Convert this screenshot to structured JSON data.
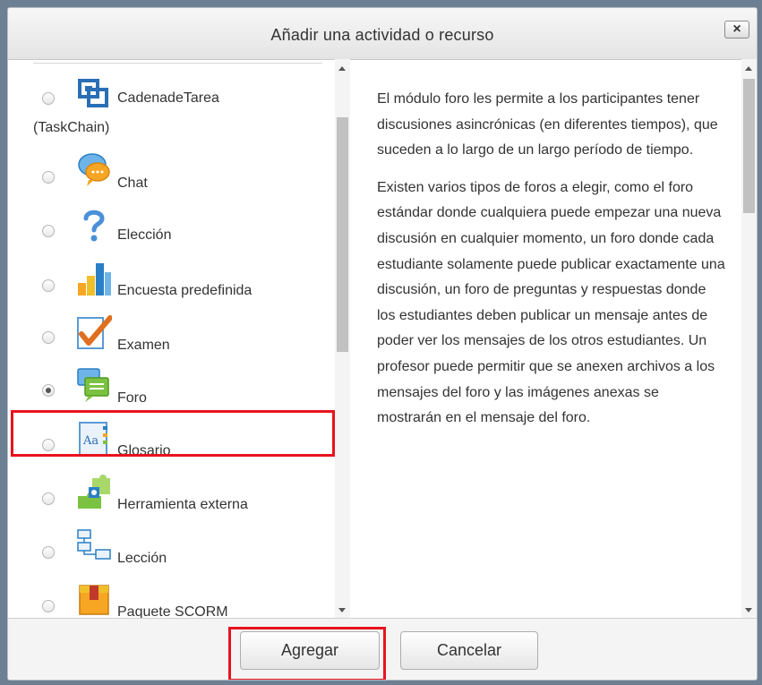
{
  "dialog": {
    "title": "Añadir una actividad o recurso",
    "close_label": "×"
  },
  "options": [
    {
      "label": "CadenadeTarea",
      "label_cont": "(TaskChain)",
      "icon": "taskchain-icon",
      "selected": false
    },
    {
      "label": "Chat",
      "icon": "chat-icon",
      "selected": false
    },
    {
      "label": "Elección",
      "icon": "question-icon",
      "selected": false
    },
    {
      "label": "Encuesta predefinida",
      "icon": "bar-chart-icon",
      "selected": false
    },
    {
      "label": "Examen",
      "icon": "checkmark-icon",
      "selected": false
    },
    {
      "label": "Foro",
      "icon": "forum-icon",
      "selected": true
    },
    {
      "label": "Glosario",
      "icon": "glossary-icon",
      "selected": false
    },
    {
      "label": "Herramienta externa",
      "icon": "puzzle-icon",
      "selected": false
    },
    {
      "label": "Lección",
      "icon": "lesson-icon",
      "selected": false
    },
    {
      "label": "Paquete SCORM",
      "icon": "scorm-package-icon",
      "selected": false
    }
  ],
  "description": {
    "paragraph1": "El módulo foro les permite a los participantes tener discusiones asincrónicas (en diferentes tiempos), que suceden a lo largo de un largo período de tiempo.",
    "paragraph2": "Existen varios tipos de foros a elegir, como el foro estándar donde cualquiera puede empezar una nueva discusión en cualquier momento, un foro donde cada estudiante solamente puede publicar exactamente una discusión, un foro de preguntas y respuestas donde los estudiantes deben publicar un mensaje antes de poder ver los mensajes de los otros estudiantes. Un profesor puede permitir que se anexen archivos a los mensajes del foro y las imágenes anexas se mostrarán en el mensaje del foro."
  },
  "footer": {
    "add_label": "Agregar",
    "cancel_label": "Cancelar"
  },
  "colors": {
    "highlight": "#e8141d",
    "icon_blue": "#2a7fc6"
  }
}
